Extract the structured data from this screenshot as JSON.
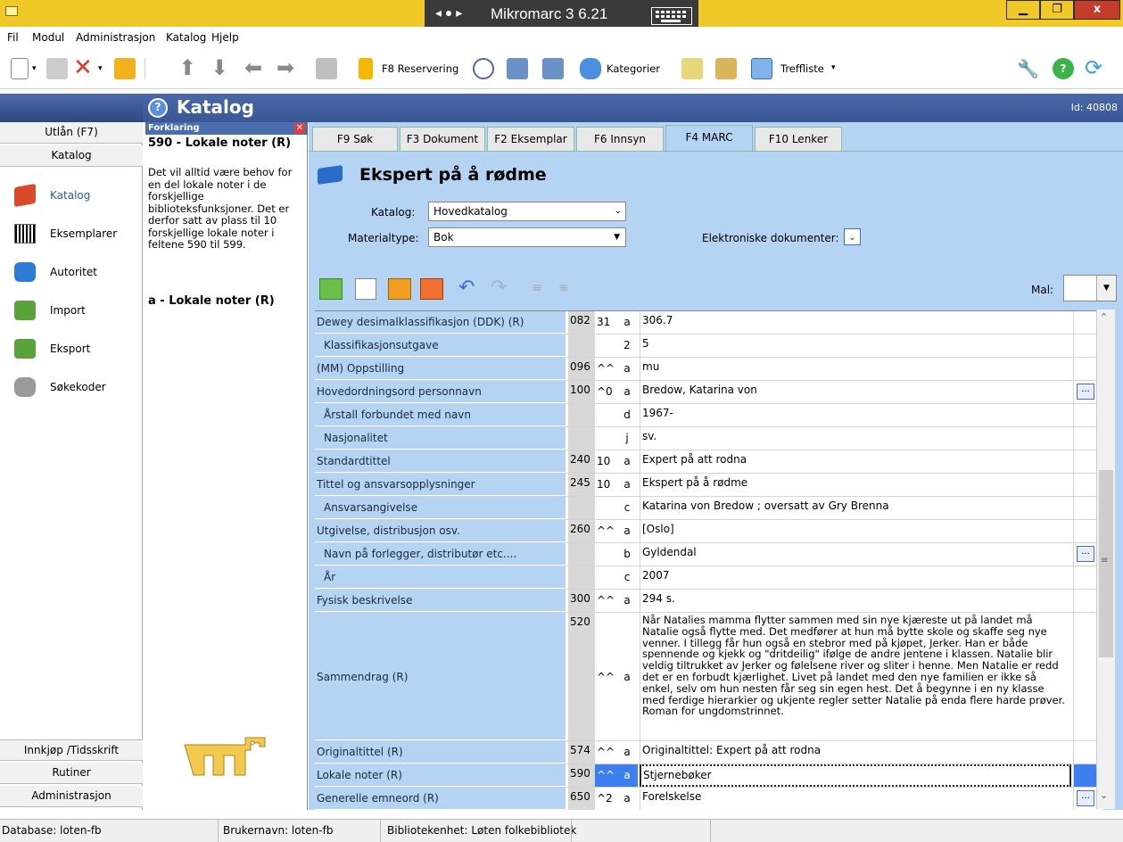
{
  "window": {
    "title": "Mikromarc 3 6.21",
    "controls": {
      "min": "▁",
      "max": "❐",
      "close": "x"
    }
  },
  "menu": [
    "Fil",
    "Modul",
    "Administrasjon",
    "Katalog",
    "Hjelp"
  ],
  "toolbar": {
    "reservation_label": "F8 Reservering",
    "categories_label": "Kategorier",
    "hitlist_label": "Treffliste"
  },
  "header": {
    "title": "Katalog",
    "id": "Id: 40808"
  },
  "leftnav": {
    "top_tabs": [
      "Utlån (F7)",
      "Katalog"
    ],
    "items": [
      {
        "label": "Katalog",
        "icon": "book-icon"
      },
      {
        "label": "Eksemplarer",
        "icon": "barcode-icon"
      },
      {
        "label": "Autoritet",
        "icon": "authority-icon"
      },
      {
        "label": "Import",
        "icon": "import-icon"
      },
      {
        "label": "Eksport",
        "icon": "export-icon"
      },
      {
        "label": "Søkekoder",
        "icon": "searchcodes-icon"
      }
    ],
    "bottom_tabs": [
      "Innkjøp /Tidsskrift",
      "Rutiner",
      "Administrasjon"
    ]
  },
  "help": {
    "bar_label": "Forklaring",
    "heading": "590 - Lokale noter (R)",
    "body": "Det vil alltid være behov for en del lokale noter i de forskjellige biblioteksfunksjoner. Det er derfor satt av plass til 10 forskjellige lokale noter i feltene 590 til 599.",
    "sub_heading": "a - Lokale noter (R)"
  },
  "tabs": [
    "F9 Søk",
    "F3 Dokument",
    "F2 Eksemplar",
    "F6 Innsyn",
    "F4 MARC",
    "F10 Lenker"
  ],
  "active_tab": "F4 MARC",
  "record": {
    "title": "Ekspert på å rødme",
    "catalog_label": "Katalog:",
    "catalog_value": "Hovedkatalog",
    "material_label": "Materialtype:",
    "material_value": "Bok",
    "edocs_label": "Elektroniske dokumenter:",
    "template_label": "Mal:"
  },
  "marc_rows": [
    {
      "name": "Dewey desimalklassifikasjon (DDK) (R)",
      "tag": "082",
      "ind": "31",
      "sub": "a",
      "value": "306.7",
      "level": 0,
      "btn": false
    },
    {
      "name": "Klassifikasjonsutgave",
      "tag": "",
      "ind": "",
      "sub": "2",
      "value": "5",
      "level": 1,
      "btn": false
    },
    {
      "name": "(MM) Oppstilling",
      "tag": "096",
      "ind": "^^",
      "sub": "a",
      "value": "mu",
      "level": 0,
      "btn": false
    },
    {
      "name": "Hovedordningsord personnavn",
      "tag": "100",
      "ind": "^0",
      "sub": "a",
      "value": "Bredow, Katarina von",
      "level": 0,
      "btn": true
    },
    {
      "name": "Årstall forbundet med navn",
      "tag": "",
      "ind": "",
      "sub": "d",
      "value": "1967-",
      "level": 1,
      "btn": false
    },
    {
      "name": "Nasjonalitet",
      "tag": "",
      "ind": "",
      "sub": "j",
      "value": "sv.",
      "level": 1,
      "btn": false
    },
    {
      "name": "Standardtittel",
      "tag": "240",
      "ind": "10",
      "sub": "a",
      "value": "Expert på att rodna",
      "level": 0,
      "btn": false
    },
    {
      "name": "Tittel og ansvarsopplysninger",
      "tag": "245",
      "ind": "10",
      "sub": "a",
      "value": "Ekspert på å rødme",
      "level": 0,
      "btn": false
    },
    {
      "name": "Ansvarsangivelse",
      "tag": "",
      "ind": "",
      "sub": "c",
      "value": "Katarina von Bredow ; oversatt av Gry Brenna",
      "level": 1,
      "btn": false
    },
    {
      "name": "Utgivelse, distribusjon osv.",
      "tag": "260",
      "ind": "^^",
      "sub": "a",
      "value": "[Oslo]",
      "level": 0,
      "btn": false
    },
    {
      "name": "Navn på forlegger, distributør etc....",
      "tag": "",
      "ind": "",
      "sub": "b",
      "value": "Gyldendal",
      "level": 1,
      "btn": true
    },
    {
      "name": "År",
      "tag": "",
      "ind": "",
      "sub": "c",
      "value": "2007",
      "level": 1,
      "btn": false
    },
    {
      "name": "Fysisk beskrivelse",
      "tag": "300",
      "ind": "^^",
      "sub": "a",
      "value": "294 s.",
      "level": 0,
      "btn": false
    },
    {
      "name": "Sammendrag (R)",
      "tag": "520",
      "ind": "^^",
      "sub": "a",
      "value": "Når Natalies mamma flytter sammen med sin nye kjæreste ut på landet må Natalie også flytte med. Det medfører at hun må bytte skole og skaffe seg nye venner. I tillegg får hun også en stebror med på kjøpet, Jerker. Han er både spennende og kjekk og \"dritdeilig\" ifølge de andre jentene i klassen. Natalie blir veldig tiltrukket av Jerker og følelsene river og sliter i henne. Men Natalie er redd det er en forbudt kjærlighet. Livet på landet med den nye familien er ikke så enkel, selv om hun nesten får seg sin egen hest. Det å begynne i en ny klasse med ferdige hierarkier og ukjente regler setter Natalie på enda flere harde prøver. Roman for ungdomstrinnet.",
      "level": 0,
      "btn": false
    },
    {
      "name": "Originaltittel (R)",
      "tag": "574",
      "ind": "^^",
      "sub": "a",
      "value": "Originaltittel: Expert på att rodna",
      "level": 0,
      "btn": false
    },
    {
      "name": "Lokale noter (R)",
      "tag": "590",
      "ind": "^^",
      "sub": "a",
      "value": "Stjernebøker",
      "level": 0,
      "btn": false,
      "selected": true
    },
    {
      "name": "Generelle emneord (R)",
      "tag": "650",
      "ind": "^2",
      "sub": "a",
      "value": "Forelskelse",
      "level": 0,
      "btn": true
    }
  ],
  "status": {
    "database": "Database: loten-fb",
    "user": "Brukernavn: loten-fb",
    "unit": "Bibliotekenhet: Løten folkebibliotek"
  }
}
